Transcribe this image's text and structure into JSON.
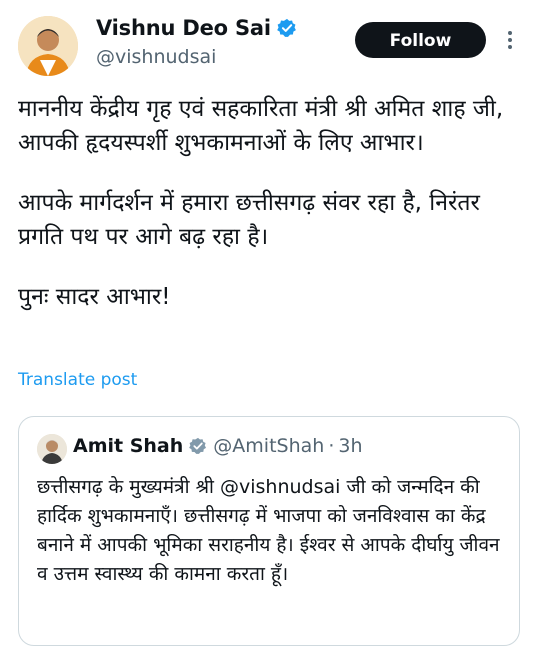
{
  "post": {
    "author_name": "Vishnu Deo Sai",
    "author_handle": "@vishnudsai",
    "follow_label": "Follow",
    "paragraphs": [
      "माननीय केंद्रीय गृह एवं सहकारिता मंत्री श्री अमित शाह जी, आपकी हृदयस्पर्शी शुभकामनाओं के लिए आभार।",
      "आपके मार्गदर्शन में हमारा छत्तीसगढ़ संवर रहा है, निरंतर प्रगति पथ पर आगे बढ़ रहा है।",
      "पुनः सादर आभार!"
    ],
    "translate_label": "Translate post"
  },
  "quote": {
    "author_name": "Amit Shah",
    "author_handle": "@AmitShah",
    "separator": "·",
    "time": "3h",
    "text": "छत्तीसगढ़ के मुख्यमंत्री श्री @vishnudsai जी को जन्मदिन की हार्दिक शुभकामनाएँ। छत्तीसगढ़ में भाजपा को जनविश्वास का केंद्र बनाने में आपकी भूमिका सराहनीय है। ईश्वर से आपके दीर्घायु जीवन व उत्तम स्वास्थ्य की कामना करता हूँ।"
  },
  "colors": {
    "accent": "#1d9bf0",
    "text": "#0f1419",
    "muted": "#536471",
    "verified_badge": "#1d9bf0",
    "border": "#cfd9de"
  },
  "icons": [
    "avatar",
    "verified-badge-icon",
    "more-options-icon",
    "quote-avatar"
  ]
}
